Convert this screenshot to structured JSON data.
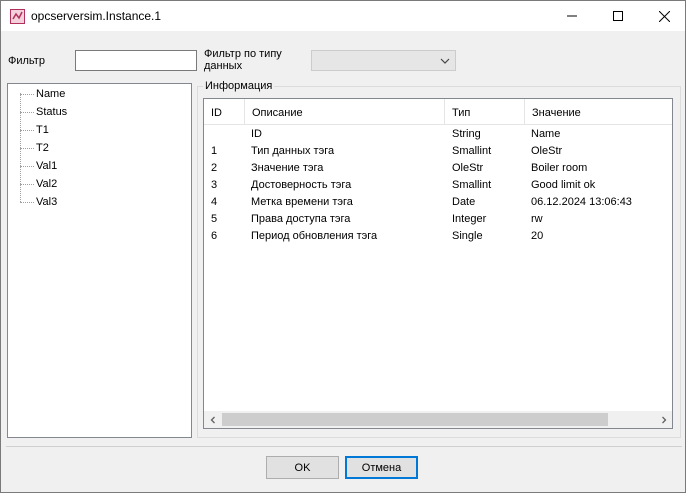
{
  "window": {
    "title": "opcserversim.Instance.1",
    "controls": {
      "minimize": "minimize",
      "maximize": "maximize",
      "close": "close"
    }
  },
  "filter": {
    "label": "Фильтр",
    "value": "",
    "type_filter_label_1": "Фильтр по типу",
    "type_filter_label_2": "данных",
    "type_filter_value": ""
  },
  "tree": {
    "items": [
      "Name",
      "Status",
      "T1",
      "T2",
      "Val1",
      "Val2",
      "Val3"
    ]
  },
  "info": {
    "title": "Информация",
    "columns": [
      "ID",
      "Описание",
      "Тип",
      "Значение"
    ],
    "rows": [
      {
        "id": "",
        "desc": "ID",
        "type": "String",
        "value": "Name"
      },
      {
        "id": "1",
        "desc": "Тип данных тэга",
        "type": "Smallint",
        "value": "OleStr"
      },
      {
        "id": "2",
        "desc": "Значение тэга",
        "type": "OleStr",
        "value": "Boiler room"
      },
      {
        "id": "3",
        "desc": "Достоверность тэга",
        "type": "Smallint",
        "value": "Good limit ok"
      },
      {
        "id": "4",
        "desc": "Метка времени тэга",
        "type": "Date",
        "value": "06.12.2024 13:06:43"
      },
      {
        "id": "5",
        "desc": "Права доступа тэга",
        "type": "Integer",
        "value": "rw"
      },
      {
        "id": "6",
        "desc": "Период обновления тэга",
        "type": "Single",
        "value": "20"
      }
    ]
  },
  "buttons": {
    "ok": "OK",
    "cancel": "Отмена"
  },
  "colors": {
    "focus_border": "#0078d7",
    "window_bg": "#f0f0f0"
  }
}
